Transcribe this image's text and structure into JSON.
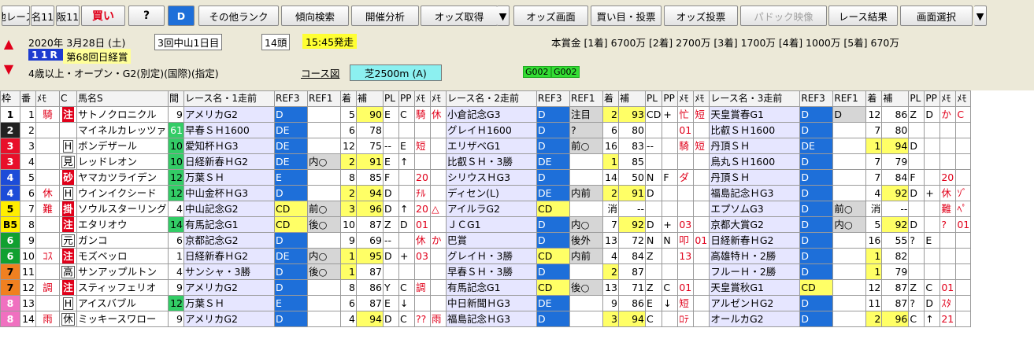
{
  "toolbar": {
    "buttons": [
      "他レース",
      "名11",
      "阪11",
      "買い",
      "?",
      "D",
      "その他ランク",
      "傾向検索",
      "開催分析",
      "オッズ取得",
      "▼",
      "オッズ画面",
      "買い目・投票",
      "オッズ投票",
      "パドック映像",
      "レース結果",
      "画面選択",
      "▼"
    ]
  },
  "race": {
    "date": "2020年 3月28日 (土)",
    "kaisai": "3回中山1日目",
    "heads": "14頭",
    "start": "15:45発走",
    "prize": "本賞金 [1着] 6700万 [2着] 2700万 [3着] 1700万 [4着] 1000万 [5着] 670万",
    "race_no": "11R",
    "race_name": "第68回日経賞",
    "conditions": "4歳以上・オープン・G2(別定)(国際)(指定)",
    "course_label": "コース図",
    "course": "芝2500m (A)",
    "badges": [
      "G002",
      "G002"
    ]
  },
  "headers": [
    "枠",
    "番",
    "ﾒﾓ",
    "C",
    "馬名S",
    "間",
    "レース名・1走前",
    "REF3",
    "REF1",
    "着",
    "補",
    "PL",
    "PP",
    "ﾒﾓ",
    "ﾒﾓ",
    "レース名・2走前",
    "REF3",
    "REF1",
    "着",
    "補",
    "PL",
    "PP",
    "ﾒﾓ",
    "ﾒﾓ",
    "レース名・3走前",
    "REF3",
    "REF1",
    "着",
    "補",
    "PL",
    "PP",
    "ﾒﾓ",
    "ﾒﾓ"
  ],
  "rows": [
    {
      "waku": "1",
      "wc": "w1",
      "ban": "1",
      "memo": "騎",
      "c": "注",
      "name": "サトノクロニクル",
      "kan": "9",
      "r1": [
        "アメリカG2",
        "D",
        "",
        "5",
        "90",
        "E",
        "C",
        "騎",
        "休"
      ],
      "r2": [
        "小倉記念G3",
        "D",
        "注目",
        "2",
        "93",
        "CD",
        "+",
        "忙",
        "短"
      ],
      "r3": [
        "天皇賞春G1",
        "D",
        "D",
        "12",
        "86",
        "Z",
        "D",
        "か",
        "C"
      ]
    },
    {
      "waku": "2",
      "wc": "w2",
      "ban": "2",
      "memo": "",
      "c": "",
      "name": "マイネルカレッツァ",
      "kan": "61",
      "r1": [
        "早春ＳＨ1600",
        "DE",
        "",
        "6",
        "78",
        "",
        "",
        "",
        ""
      ],
      "r2": [
        "グレイＨ1600",
        "D",
        "?",
        "6",
        "80",
        "",
        "",
        "01",
        ""
      ],
      "r3": [
        "比叡ＳＨ1600",
        "D",
        "",
        "7",
        "80",
        "",
        "",
        "",
        ""
      ]
    },
    {
      "waku": "3",
      "wc": "w3",
      "ban": "3",
      "memo": "",
      "c": "H",
      "name": "ボンデザール",
      "kan": "10",
      "r1": [
        "愛知杯ＨG3",
        "DE",
        "",
        "12",
        "75",
        "--",
        "E",
        "短",
        ""
      ],
      "r2": [
        "エリザベG1",
        "D",
        "前○",
        "16",
        "83",
        "--",
        "",
        "騎",
        "短"
      ],
      "r3": [
        "丹頂ＳＨ",
        "DE",
        "",
        "1",
        "94",
        "D",
        "",
        "",
        ""
      ]
    },
    {
      "waku": "3",
      "wc": "w3",
      "ban": "4",
      "memo": "",
      "c": "見",
      "name": "レッドレオン",
      "kan": "10",
      "r1": [
        "日経新春ＨG2",
        "DE",
        "内○",
        "2",
        "91",
        "E",
        "↑",
        "",
        ""
      ],
      "r2": [
        "比叡ＳＨ・3勝",
        "DE",
        "",
        "1",
        "85",
        "",
        "",
        "",
        ""
      ],
      "r3": [
        "鳥丸ＳＨ1600",
        "D",
        "",
        "7",
        "79",
        "",
        "",
        "",
        ""
      ]
    },
    {
      "waku": "4",
      "wc": "w4",
      "ban": "5",
      "memo": "",
      "c": "砂",
      "name": "ヤマカツライデン",
      "kan": "12",
      "r1": [
        "万葉ＳＨ",
        "E",
        "",
        "8",
        "85",
        "F",
        "",
        "20",
        ""
      ],
      "r2": [
        "シリウスＨG3",
        "D",
        "",
        "14",
        "50",
        "N",
        "F",
        "ダ",
        ""
      ],
      "r3": [
        "丹頂ＳＨ",
        "D",
        "",
        "7",
        "84",
        "F",
        "",
        "20",
        ""
      ]
    },
    {
      "waku": "4",
      "wc": "w4",
      "ban": "6",
      "memo": "休",
      "c": "H",
      "name": "ウインイクシード",
      "kan": "12",
      "r1": [
        "中山金杯ＨG3",
        "D",
        "",
        "2",
        "94",
        "D",
        "",
        "ﾁﾙ",
        ""
      ],
      "r2": [
        "ディセン(L)",
        "DE",
        "内前",
        "2",
        "91",
        "D",
        "",
        "",
        ""
      ],
      "r3": [
        "福島記念ＨG3",
        "D",
        "",
        "4",
        "92",
        "D",
        "+",
        "休",
        "ｿﾞ"
      ]
    },
    {
      "waku": "5",
      "wc": "w5",
      "ban": "7",
      "memo": "難",
      "c": "掛",
      "name": "ソウルスターリング",
      "kan": "4",
      "r1": [
        "中山記念G2",
        "CD",
        "前○",
        "3",
        "96",
        "D",
        "↑",
        "20",
        "△"
      ],
      "r2": [
        "アイルラG2",
        "CD",
        "",
        "消",
        "--",
        "",
        "",
        "",
        ""
      ],
      "r3": [
        "エプソムG3",
        "D",
        "前○",
        "消",
        "--",
        "",
        "",
        "難",
        "ﾍﾟ"
      ]
    },
    {
      "waku": "B5",
      "wc": "w5",
      "ban": "8",
      "memo": "",
      "c": "注",
      "name": "エタリオウ",
      "kan": "14",
      "r1": [
        "有馬記念G1",
        "CD",
        "後○",
        "10",
        "87",
        "Z",
        "D",
        "01",
        ""
      ],
      "r2": [
        "ＪＣG1",
        "D",
        "内○",
        "7",
        "92",
        "D",
        "+",
        "03",
        ""
      ],
      "r3": [
        "京都大賞G2",
        "D",
        "内○",
        "5",
        "92",
        "D",
        "",
        "?",
        "01"
      ]
    },
    {
      "waku": "6",
      "wc": "w6",
      "ban": "9",
      "memo": "",
      "c": "元",
      "name": "ガンコ",
      "kan": "6",
      "r1": [
        "京都記念G2",
        "D",
        "",
        "9",
        "69",
        "--",
        "",
        "休",
        "か"
      ],
      "r2": [
        "巴賞",
        "D",
        "後外",
        "13",
        "72",
        "N",
        "N",
        "叩",
        "01"
      ],
      "r3": [
        "日経新春ＨG2",
        "D",
        "",
        "16",
        "55",
        "?",
        "E",
        "",
        ""
      ]
    },
    {
      "waku": "6",
      "wc": "w6",
      "ban": "10",
      "memo": "ｺｽ",
      "c": "注",
      "name": "モズベッロ",
      "kan": "1",
      "r1": [
        "日経新春ＨG2",
        "DE",
        "内○",
        "1",
        "95",
        "D",
        "+",
        "03",
        ""
      ],
      "r2": [
        "グレイＨ・3勝",
        "CD",
        "内前",
        "4",
        "84",
        "Z",
        "",
        "13",
        ""
      ],
      "r3": [
        "高雄特Ｈ・2勝",
        "D",
        "",
        "1",
        "82",
        "",
        "",
        "",
        ""
      ]
    },
    {
      "waku": "7",
      "wc": "w7",
      "ban": "11",
      "memo": "",
      "c": "高",
      "name": "サンアップルトン",
      "kan": "4",
      "r1": [
        "サンシャ・3勝",
        "D",
        "後○",
        "1",
        "87",
        "",
        "",
        "",
        ""
      ],
      "r2": [
        "早春ＳＨ・3勝",
        "D",
        "",
        "2",
        "87",
        "",
        "",
        "",
        ""
      ],
      "r3": [
        "フルーＨ・2勝",
        "D",
        "",
        "1",
        "79",
        "",
        "",
        "",
        ""
      ]
    },
    {
      "waku": "7",
      "wc": "w7",
      "ban": "12",
      "memo": "調",
      "c": "注",
      "name": "スティッフェリオ",
      "kan": "9",
      "r1": [
        "アメリカG2",
        "D",
        "",
        "8",
        "86",
        "Y",
        "C",
        "調",
        ""
      ],
      "r2": [
        "有馬記念G1",
        "CD",
        "後○",
        "13",
        "71",
        "Z",
        "C",
        "01",
        ""
      ],
      "r3": [
        "天皇賞秋G1",
        "CD",
        "",
        "12",
        "87",
        "Z",
        "C",
        "01",
        ""
      ]
    },
    {
      "waku": "8",
      "wc": "w8",
      "ban": "13",
      "memo": "",
      "c": "H",
      "name": "アイスバブル",
      "kan": "12",
      "r1": [
        "万葉ＳＨ",
        "E",
        "",
        "6",
        "87",
        "E",
        "↓",
        "",
        ""
      ],
      "r2": [
        "中日新聞ＨG3",
        "DE",
        "",
        "9",
        "86",
        "E",
        "↓",
        "短",
        ""
      ],
      "r3": [
        "アルゼンＨG2",
        "D",
        "",
        "11",
        "87",
        "?",
        "D",
        "ｽﾀ",
        ""
      ]
    },
    {
      "waku": "8",
      "wc": "w8",
      "ban": "14",
      "memo": "雨",
      "c": "休",
      "name": "ミッキースワロー",
      "kan": "9",
      "r1": [
        "アメリカG2",
        "D",
        "",
        "4",
        "94",
        "D",
        "C",
        "??",
        "雨"
      ],
      "r2": [
        "福島記念ＨG3",
        "D",
        "",
        "3",
        "94",
        "C",
        "",
        "ﾛﾃ",
        ""
      ],
      "r3": [
        "オールカG2",
        "D",
        "",
        "2",
        "96",
        "C",
        "↑",
        "21",
        ""
      ]
    }
  ]
}
